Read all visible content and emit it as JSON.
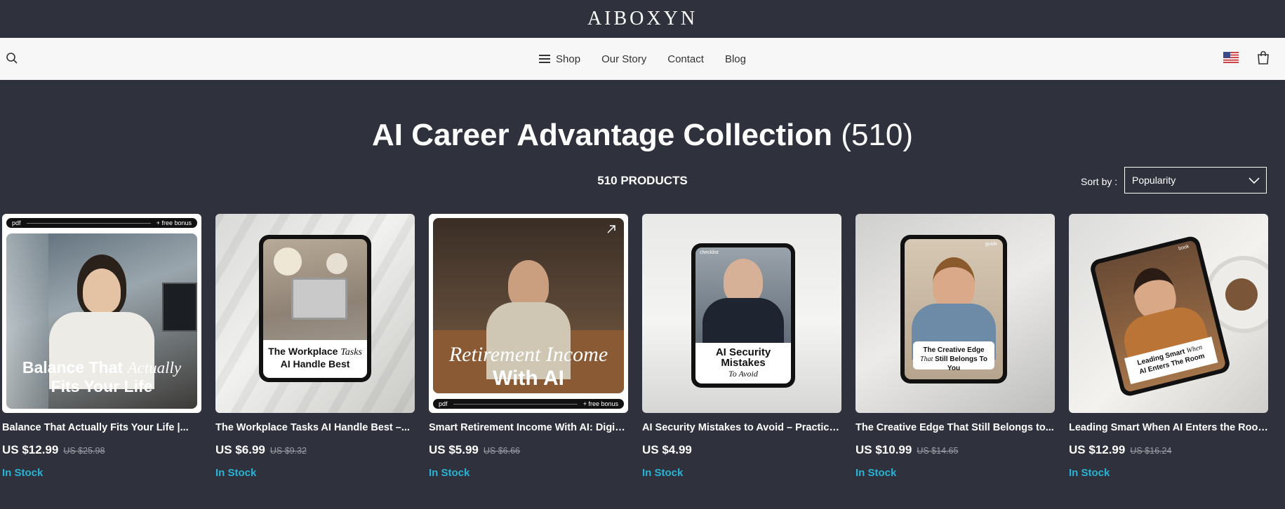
{
  "brand": "AIBOXYN",
  "nav": {
    "items": [
      {
        "label": "Shop"
      },
      {
        "label": "Our Story"
      },
      {
        "label": "Contact"
      },
      {
        "label": "Blog"
      }
    ],
    "icons": [
      "search-icon",
      "menu-icon",
      "us-flag-icon",
      "shopping-bag-icon"
    ]
  },
  "collection": {
    "title": "AI Career Advantage Collection",
    "count": "(510)",
    "products_count": "510 PRODUCTS"
  },
  "sort": {
    "label": "Sort by :",
    "selected": "Popularity"
  },
  "products": [
    {
      "title": "Balance That Actually Fits Your Life |...",
      "price": "US $12.99",
      "old_price": "US $25.98",
      "stock": "In Stock",
      "thumb": {
        "tag_left": "pdf",
        "tag_right": "+ free bonus",
        "caption_1": "Balance That",
        "caption_italic": "Actually",
        "caption_2": "Fits Your Life"
      }
    },
    {
      "title": "The Workplace Tasks AI Handle Best –...",
      "price": "US $6.99",
      "old_price": "US $9.32",
      "stock": "In Stock",
      "thumb": {
        "caption_1": "The Workplace",
        "caption_italic": "Tasks",
        "caption_2": "AI Handle Best"
      }
    },
    {
      "title": "Smart Retirement Income With AI: Digita...",
      "price": "US $5.99",
      "old_price": "US $6.66",
      "stock": "In Stock",
      "thumb": {
        "tag_left": "pdf",
        "tag_right": "+ free bonus",
        "caption_italic": "Retirement Income",
        "caption_2": "With AI"
      }
    },
    {
      "title": "AI Security Mistakes to Avoid – Practical...",
      "price": "US $4.99",
      "old_price": "",
      "stock": "In Stock",
      "thumb": {
        "tag_left": "checklist",
        "caption_1": "AI Security",
        "caption_2": "Mistakes",
        "caption_italic": "To Avoid"
      }
    },
    {
      "title": "The Creative Edge That Still Belongs to...",
      "price": "US $10.99",
      "old_price": "US $14.65",
      "stock": "In Stock",
      "thumb": {
        "tag_right": "guide",
        "caption_1": "The Creative Edge",
        "caption_italic": "That",
        "caption_2": "Still Belongs To You"
      }
    },
    {
      "title": "Leading Smart When AI Enters the Room...",
      "price": "US $12.99",
      "old_price": "US $16.24",
      "stock": "In Stock",
      "thumb": {
        "tag_right": "book",
        "caption_1": "Leading Smart",
        "caption_italic": "When",
        "caption_2": "AI Enters The Room"
      }
    }
  ]
}
